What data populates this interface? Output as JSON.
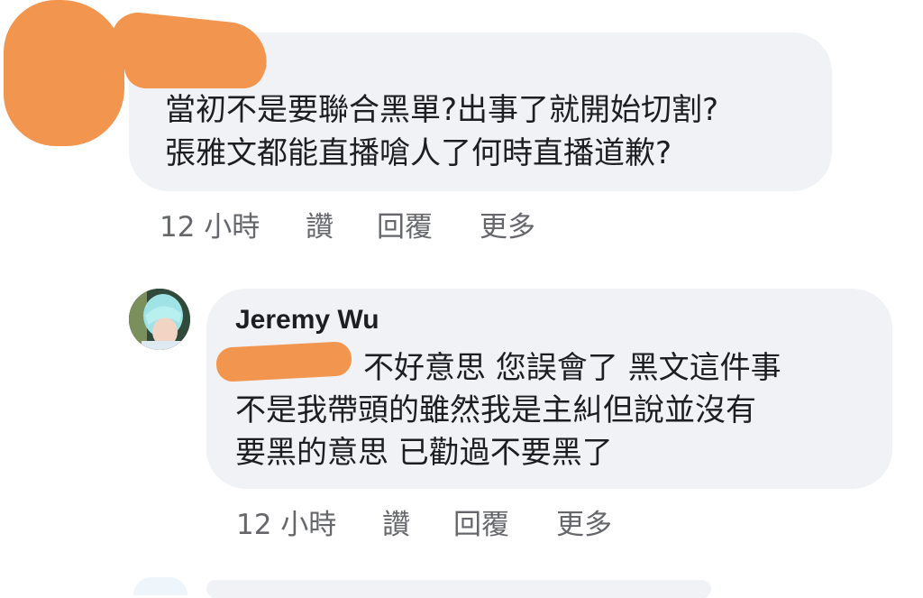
{
  "comment1": {
    "lines": [
      "當初不是要聯合黑單?出事了就開始切割?",
      "張雅文都能直播嗆人了何時直播道歉?"
    ],
    "time": "12 小時",
    "like": "讚",
    "reply": "回覆",
    "more": "更多"
  },
  "comment2": {
    "author": "Jeremy Wu",
    "lines": [
      "不好意思 您誤會了 黑文這件事",
      "不是我帶頭的雖然我是主糾但說並沒有",
      "要黑的意思 已勸過不要黑了"
    ],
    "time": "12 小時",
    "like": "讚",
    "reply": "回覆",
    "more": "更多"
  },
  "colors": {
    "bubble": "#f0f2f5",
    "text": "#1c1e21",
    "meta": "#65676b",
    "redaction": "#f2954f"
  }
}
